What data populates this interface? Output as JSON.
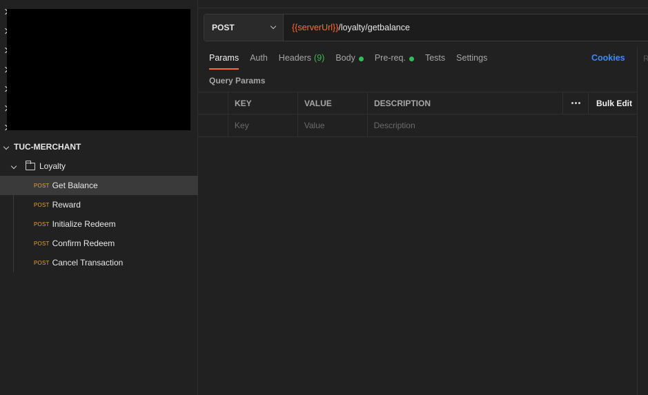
{
  "sidebar": {
    "collapsed_rows": 7,
    "collection": {
      "label": "TUC-MERCHANT"
    },
    "folder": {
      "label": "Loyalty"
    },
    "requests": [
      {
        "method": "POST",
        "label": "Get Balance",
        "active": true
      },
      {
        "method": "POST",
        "label": "Reward"
      },
      {
        "method": "POST",
        "label": "Initialize Redeem"
      },
      {
        "method": "POST",
        "label": "Confirm Redeem"
      },
      {
        "method": "POST",
        "label": "Cancel Transaction"
      }
    ]
  },
  "request": {
    "method": "POST",
    "url_variable": "{{serverUrl}}",
    "url_path": "/loyalty/getbalance"
  },
  "tabs": {
    "params": "Params",
    "auth": "Auth",
    "headers": "Headers",
    "headers_count": "(9)",
    "body": "Body",
    "prereq": "Pre-req.",
    "tests": "Tests",
    "settings": "Settings",
    "cookies": "Cookies",
    "right_edge": "R"
  },
  "query_params": {
    "title": "Query Params",
    "columns": {
      "key": "KEY",
      "value": "VALUE",
      "description": "DESCRIPTION"
    },
    "bulk_edit": "Bulk Edit",
    "placeholders": {
      "key": "Key",
      "value": "Value",
      "description": "Description"
    }
  },
  "colors": {
    "accent": "#ff6c37",
    "method_post": "#e6a23c",
    "status_green": "#2fbf5b",
    "link": "#3b8bff"
  }
}
